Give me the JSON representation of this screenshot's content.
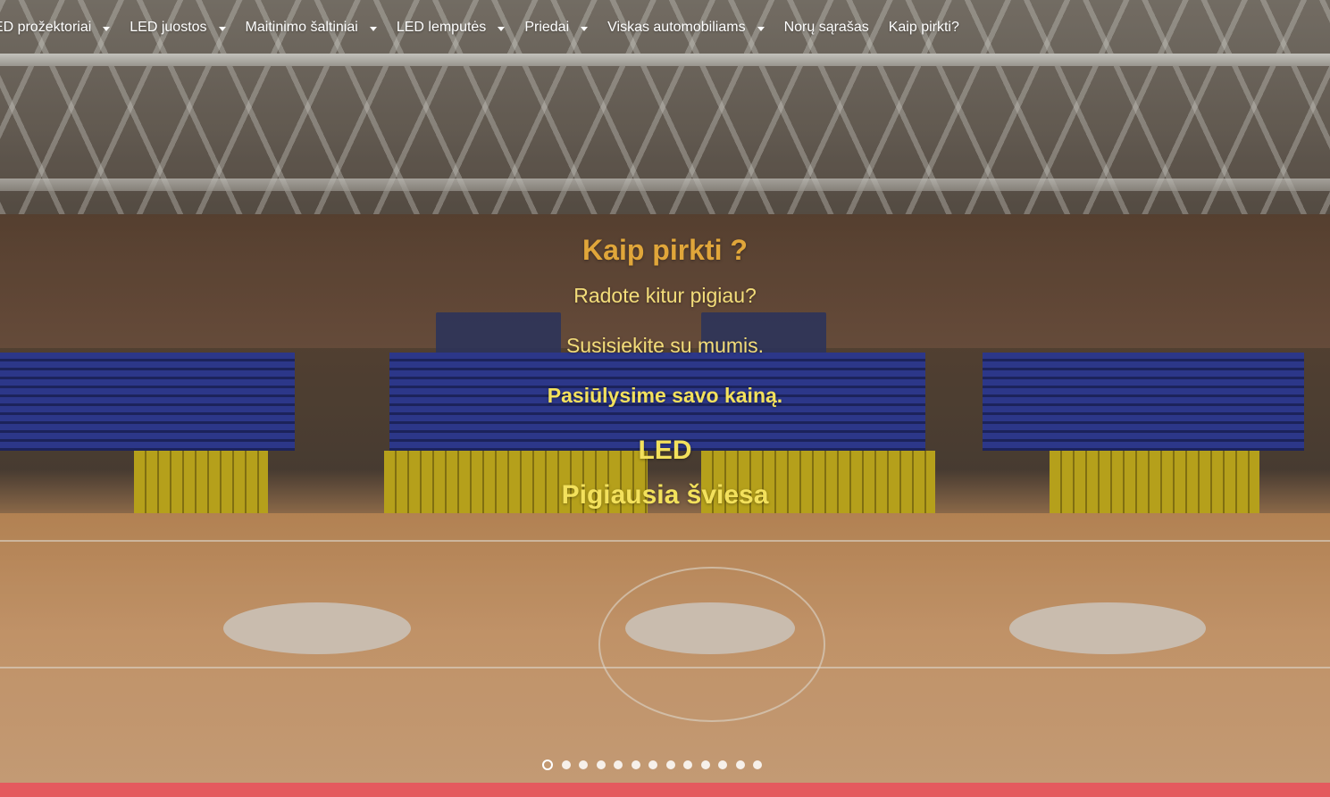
{
  "nav": {
    "items": [
      {
        "label": "LED prožektoriai",
        "has_dropdown": true
      },
      {
        "label": "LED juostos",
        "has_dropdown": true
      },
      {
        "label": "Maitinimo šaltiniai",
        "has_dropdown": true
      },
      {
        "label": "LED lemputės",
        "has_dropdown": true
      },
      {
        "label": "Priedai",
        "has_dropdown": true
      },
      {
        "label": "Viskas automobiliams",
        "has_dropdown": true
      },
      {
        "label": "Norų sąrašas",
        "has_dropdown": false
      },
      {
        "label": "Kaip pirkti?",
        "has_dropdown": false
      }
    ]
  },
  "slide": {
    "title": "Kaip pirkti ?",
    "line1": "Radote kitur pigiau?",
    "line2": "Susisiekite su mumis.",
    "line3": "Pasiūlysime savo kainą.",
    "line4": "LED",
    "line5": "Pigiausia šviesa"
  },
  "slider": {
    "total_slides": 13,
    "active_index": 0
  },
  "colors": {
    "title": "#e0a63a",
    "caption": "#f3dd7a",
    "caption_bold": "#f3e15c",
    "bottom_bar": "#e45a5e"
  }
}
